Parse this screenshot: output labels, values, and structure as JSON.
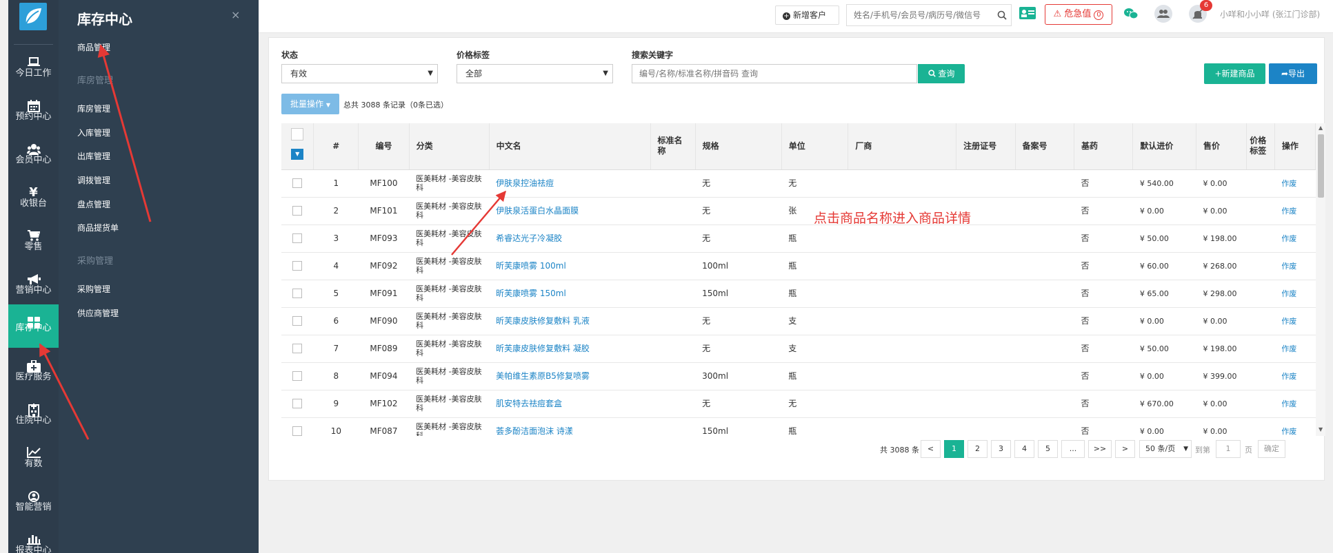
{
  "left_nav": {
    "items": [
      {
        "label": "今日工作",
        "icon": "laptop-icon"
      },
      {
        "label": "预约中心",
        "icon": "calendar-icon"
      },
      {
        "label": "会员中心",
        "icon": "users-icon"
      },
      {
        "label": "收银台",
        "icon": "yen-icon"
      },
      {
        "label": "零售",
        "icon": "cart-icon"
      },
      {
        "label": "营销中心",
        "icon": "megaphone-icon"
      },
      {
        "label": "库存中心",
        "icon": "grid-icon",
        "active": true
      },
      {
        "label": "医疗服务",
        "icon": "medkit-icon"
      },
      {
        "label": "住院中心",
        "icon": "hospital-icon"
      },
      {
        "label": "有数",
        "icon": "line-chart-icon"
      },
      {
        "label": "智能营销",
        "icon": "smart-icon"
      },
      {
        "label": "报表中心",
        "icon": "bar-chart-icon"
      }
    ]
  },
  "sub_nav": {
    "title": "库存中心",
    "close": "×",
    "items": [
      {
        "label": "商品管理",
        "type": "item"
      },
      {
        "label": "库房管理",
        "type": "group"
      },
      {
        "label": "库房管理",
        "type": "item"
      },
      {
        "label": "入库管理",
        "type": "item"
      },
      {
        "label": "出库管理",
        "type": "item"
      },
      {
        "label": "调拨管理",
        "type": "item"
      },
      {
        "label": "盘点管理",
        "type": "item"
      },
      {
        "label": "商品提货单",
        "type": "item"
      },
      {
        "label": "采购管理",
        "type": "group"
      },
      {
        "label": "采购管理",
        "type": "item"
      },
      {
        "label": "供应商管理",
        "type": "item"
      }
    ]
  },
  "topbar": {
    "add_customer": "新增客户",
    "search_placeholder": "姓名/手机号/会员号/病历号/微信号",
    "danger_label": "危急值",
    "danger_count": "0",
    "notify_count": "6",
    "user": "小咩和小小咩 (张江门诊部)"
  },
  "filters": {
    "status_label": "状态",
    "status_value": "有效",
    "price_tag_label": "价格标签",
    "price_tag_value": "全部",
    "keyword_label": "搜索关键字",
    "keyword_placeholder": "编号/名称/标准名称/拼音码 查询",
    "query_button": "查询",
    "new_button": "新建商品",
    "export_button": "导出",
    "batch_button": "批量操作",
    "total_text": "总共 3088 条记录（0条已选）"
  },
  "table": {
    "columns": [
      "#",
      "编号",
      "分类",
      "中文名",
      "标准名称",
      "规格",
      "单位",
      "厂商",
      "注册证号",
      "备案号",
      "基药",
      "默认进价",
      "售价",
      "价格标签",
      "操作"
    ],
    "rows": [
      {
        "no": "1",
        "code": "MF100",
        "cat": "医美耗材 -美容皮肤科",
        "name": "伊肤泉控油祛痘",
        "spec": "无",
        "unit": "无",
        "base": "否",
        "cost": "¥ 540.00",
        "price": "¥ 0.00",
        "op": "作废"
      },
      {
        "no": "2",
        "code": "MF101",
        "cat": "医美耗材 -美容皮肤科",
        "name": "伊肤泉活蛋白水晶面膜",
        "spec": "无",
        "unit": "张",
        "base": "否",
        "cost": "¥ 0.00",
        "price": "¥ 0.00",
        "op": "作废"
      },
      {
        "no": "3",
        "code": "MF093",
        "cat": "医美耗材 -美容皮肤科",
        "name": "希睿达光子冷凝胶",
        "spec": "无",
        "unit": "瓶",
        "base": "否",
        "cost": "¥ 50.00",
        "price": "¥ 198.00",
        "op": "作废"
      },
      {
        "no": "4",
        "code": "MF092",
        "cat": "医美耗材 -美容皮肤科",
        "name": "昕芙康喷雾 100ml",
        "spec": "100ml",
        "unit": "瓶",
        "base": "否",
        "cost": "¥ 60.00",
        "price": "¥ 268.00",
        "op": "作废"
      },
      {
        "no": "5",
        "code": "MF091",
        "cat": "医美耗材 -美容皮肤科",
        "name": "昕芙康喷雾 150ml",
        "spec": "150ml",
        "unit": "瓶",
        "base": "否",
        "cost": "¥ 65.00",
        "price": "¥ 298.00",
        "op": "作废"
      },
      {
        "no": "6",
        "code": "MF090",
        "cat": "医美耗材 -美容皮肤科",
        "name": "昕芙康皮肤修复敷料 乳液",
        "spec": "无",
        "unit": "支",
        "base": "否",
        "cost": "¥ 0.00",
        "price": "¥ 0.00",
        "op": "作废"
      },
      {
        "no": "7",
        "code": "MF089",
        "cat": "医美耗材 -美容皮肤科",
        "name": "昕芙康皮肤修复敷料 凝胶",
        "spec": "无",
        "unit": "支",
        "base": "否",
        "cost": "¥ 50.00",
        "price": "¥ 198.00",
        "op": "作废"
      },
      {
        "no": "8",
        "code": "MF094",
        "cat": "医美耗材 -美容皮肤科",
        "name": "美帕维生素原B5修复喷雾",
        "spec": "300ml",
        "unit": "瓶",
        "base": "否",
        "cost": "¥ 0.00",
        "price": "¥ 399.00",
        "op": "作废"
      },
      {
        "no": "9",
        "code": "MF102",
        "cat": "医美耗材 -美容皮肤科",
        "name": "肌安特去祛痘套盒",
        "spec": "无",
        "unit": "无",
        "base": "否",
        "cost": "¥ 670.00",
        "price": "¥ 0.00",
        "op": "作废"
      },
      {
        "no": "10",
        "code": "MF087",
        "cat": "医美耗材 -美容皮肤科",
        "name": "荟多酚洁面泡沫 诗漾",
        "spec": "150ml",
        "unit": "瓶",
        "base": "否",
        "cost": "¥ 0.00",
        "price": "¥ 0.00",
        "op": "作废"
      }
    ]
  },
  "pagination": {
    "total": "共 3088 条",
    "prev": "<",
    "pages": [
      "1",
      "2",
      "3",
      "4",
      "5",
      "..."
    ],
    "jump": ">>",
    "next": ">",
    "page_size": "50 条/页",
    "goto_prefix": "到第",
    "goto_value": "1",
    "goto_suffix": "页",
    "confirm": "确定"
  },
  "annotation": "点击商品名称进入商品详情",
  "colors": {
    "accent": "#1ab394",
    "primary": "#1c84c6",
    "danger": "#e53935",
    "nav_bg": "#2d3c4b"
  }
}
